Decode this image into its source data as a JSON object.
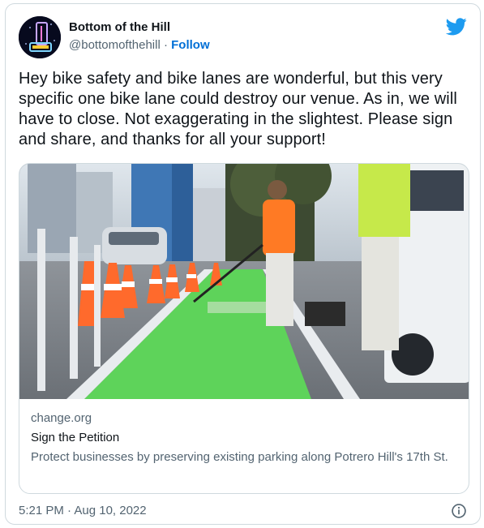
{
  "tweet": {
    "author": {
      "display_name": "Bottom of the Hill",
      "handle": "@bottomofthehill",
      "separator": "·",
      "follow_label": "Follow",
      "avatar_text": "BOTTOM"
    },
    "text": "Hey bike safety and bike lanes are wonderful, but this very specific one bike lane could destroy our venue. As in, we will have to close. Not exaggerating in the slightest. Please sign and share, and thanks for all your support!",
    "link_card": {
      "domain": "change.org",
      "title": "Sign the Petition",
      "description": "Protect businesses by preserving existing parking along Potrero Hill's 17th St.",
      "image_description": "workers painting a green bike lane lined with traffic cones"
    },
    "timestamp": "5:21 PM · Aug 10, 2022",
    "icons": {
      "brand": "twitter-bird-icon",
      "info": "info-icon"
    }
  },
  "colors": {
    "link_blue": "#006fd6",
    "twitter_blue": "#1d9bf0",
    "muted_text": "#536471",
    "border": "#cfd9de",
    "bike_lane_green": "#5ed35a"
  }
}
